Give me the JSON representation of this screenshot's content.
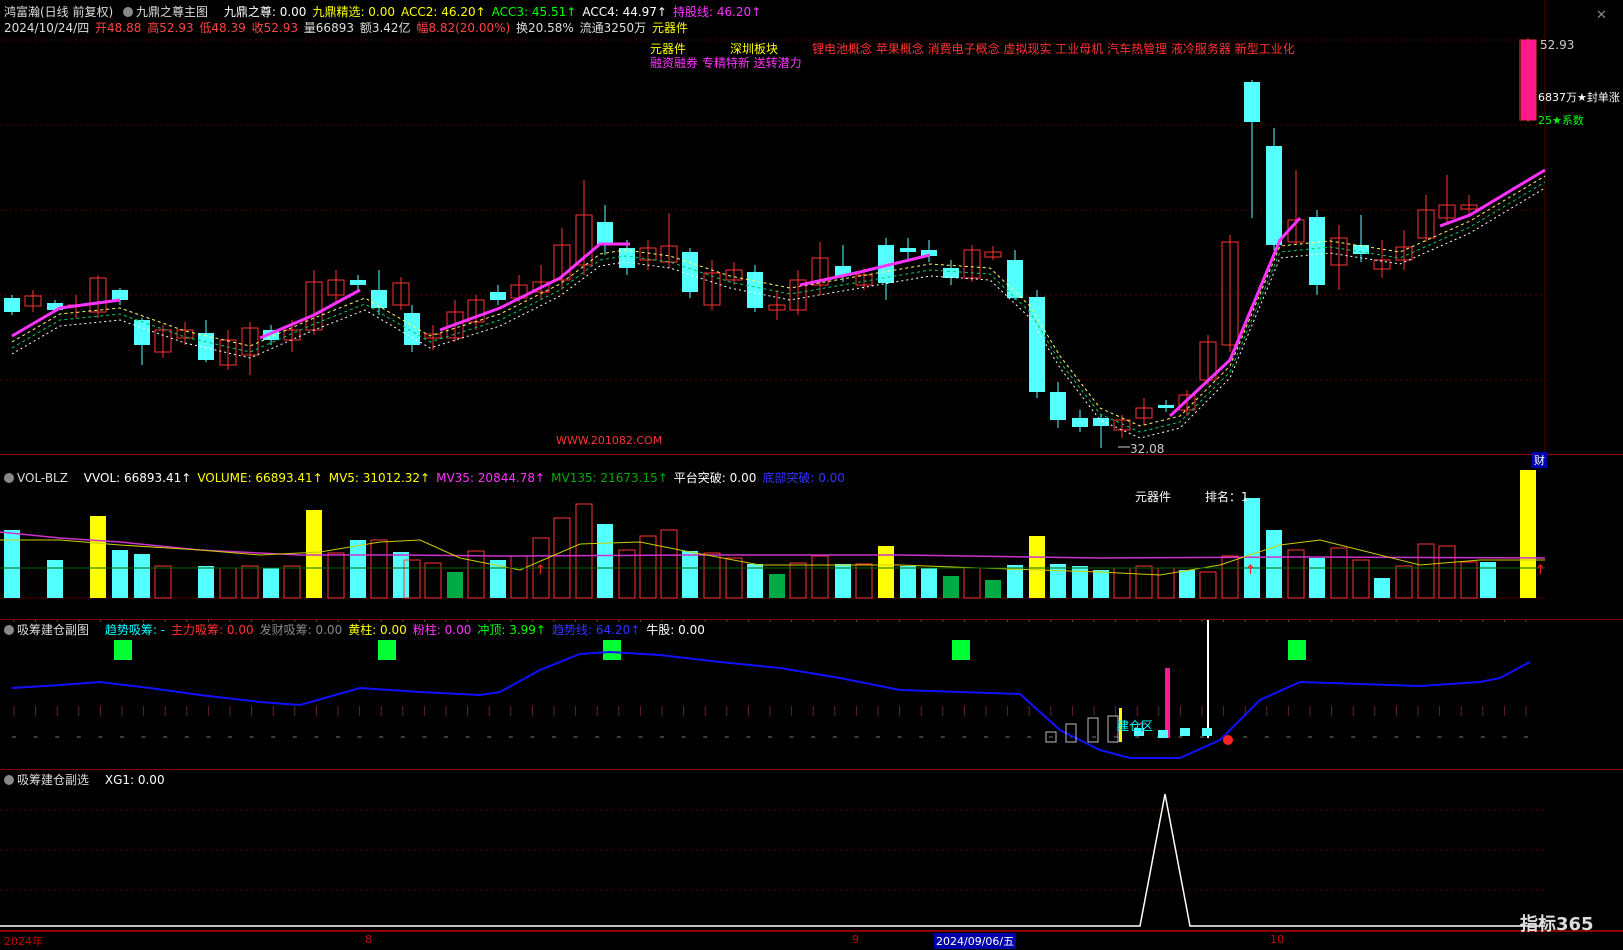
{
  "main": {
    "name": "鸿富瀚(日线 前复权)",
    "indicator": "九鼎之尊主图",
    "fields": [
      {
        "label": "九鼎之尊: 0.00",
        "color": "#ffffff"
      },
      {
        "label": "九鼎精选: 0.00",
        "color": "#ffff00"
      },
      {
        "label": "ACC2: 46.20↑",
        "color": "#ffff00"
      },
      {
        "label": "ACC3: 45.51↑",
        "color": "#00ff00"
      },
      {
        "label": "ACC4: 44.97↑",
        "color": "#ffffff"
      },
      {
        "label": "持股线: 46.20↑",
        "color": "#ff33ff"
      }
    ],
    "quote": {
      "date": "2024/10/24/四",
      "open": "开48.88",
      "high": "高52.93",
      "low": "低48.39",
      "close": "收52.93",
      "volume": "量66893",
      "amount": "额3.42亿",
      "change": "幅8.82(20.00%)",
      "turnover": "换20.58%",
      "float": "流通3250万",
      "sector": "元器件"
    },
    "tags_left_1": "元器件",
    "tags_left_2": "深圳板块",
    "tags_left_3": "融资融券 专精特新 送转潜力",
    "concepts": "锂电池概念 苹果概念 消费电子概念 虚拟现实 工业母机 汽车热管理 液冷服务器 新型工业化",
    "website": "WWW.201082.COM",
    "price_high": "52.93",
    "price_low": "32.08",
    "seal_amount": "6837万★封单涨",
    "coef": "25★系数",
    "fin_label": "财"
  },
  "vol": {
    "name": "VOL-BLZ",
    "fields": [
      {
        "label": "VVOL: 66893.41↑",
        "color": "#ffffff"
      },
      {
        "label": "VOLUME: 66893.41↑",
        "color": "#ffff00"
      },
      {
        "label": "MV5: 31012.32↑",
        "color": "#ffff00"
      },
      {
        "label": "MV35: 20844.78↑",
        "color": "#ff33ff"
      },
      {
        "label": "MV135: 21673.15↑",
        "color": "#00aa00"
      },
      {
        "label": "平台突破: 0.00",
        "color": "#ffffff"
      },
      {
        "label": "底部突破: 0.00",
        "color": "#3333ff"
      }
    ],
    "rank_sector": "元器件",
    "rank_label": "排名：1"
  },
  "sub1": {
    "name": "吸筹建仓副图",
    "fields": [
      {
        "label": "趋势吸筹: -",
        "color": "#00ffff"
      },
      {
        "label": "主力吸筹: 0.00",
        "color": "#ff3333"
      },
      {
        "label": "发财吸筹: 0.00",
        "color": "#888888"
      },
      {
        "label": "黄柱: 0.00",
        "color": "#ffff00"
      },
      {
        "label": "粉柱: 0.00",
        "color": "#ff33ff"
      },
      {
        "label": "冲顶: 3.99↑",
        "color": "#00ff00"
      },
      {
        "label": "趋势线: 64.20↑",
        "color": "#3333ff"
      },
      {
        "label": "牛股: 0.00",
        "color": "#ffffff"
      }
    ],
    "zone_label": "建仓区"
  },
  "sub2": {
    "name": "吸筹建仓副选",
    "fields": [
      {
        "label": "XG1: 0.00",
        "color": "#ffffff"
      }
    ]
  },
  "axis": {
    "labels": [
      {
        "text": "2024年",
        "pos": 0
      },
      {
        "text": "8",
        "pos": 1
      },
      {
        "text": "9",
        "pos": 2
      },
      {
        "text": "10",
        "pos": 4
      }
    ],
    "cursor_date": "2024/09/06/五"
  },
  "brand": "指标365",
  "colors": {
    "up": "#ff3333",
    "down": "#54ffff",
    "bg": "#000000",
    "grid": "#8b0000",
    "ma": "#ff33ff"
  }
}
